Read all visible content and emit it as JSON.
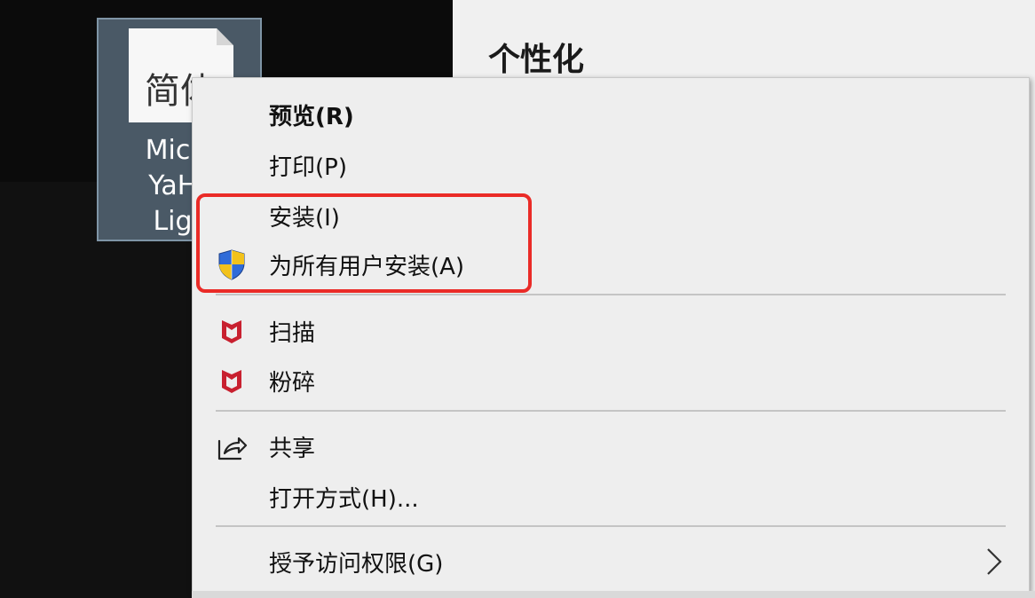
{
  "desktop": {
    "file_icon": {
      "glyph": "简体",
      "name": "Micro\nYaHe\nLigh"
    }
  },
  "settings": {
    "title": "个性化"
  },
  "context_menu": {
    "items": [
      {
        "label": "预览(R)",
        "bold": true,
        "icon": null
      },
      {
        "label": "打印(P)",
        "icon": null
      },
      {
        "label": "安装(I)",
        "icon": null
      },
      {
        "label": "为所有用户安装(A)",
        "icon": "uac-shield-icon"
      },
      {
        "label": "扫描",
        "icon": "mcafee-icon"
      },
      {
        "label": "粉碎",
        "icon": "mcafee-icon"
      },
      {
        "label": "共享",
        "icon": "share-icon"
      },
      {
        "label": "打开方式(H)...",
        "icon": null
      },
      {
        "label": "授予访问权限(G)",
        "icon": null,
        "submenu": true
      }
    ]
  },
  "colors": {
    "highlight": "#ea2b27",
    "mcafee_red": "#c8202f",
    "shield_blue": "#2f6bd8",
    "shield_yellow": "#f2c21b"
  }
}
